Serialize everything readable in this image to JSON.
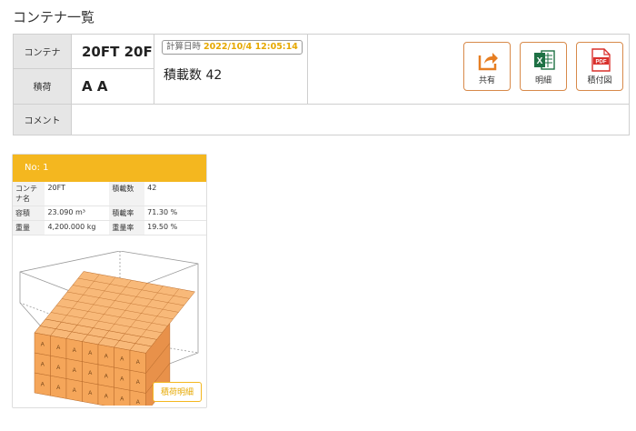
{
  "page_title": "コンテナ一覧",
  "summary": {
    "container_label": "コンテナ",
    "container_value": "20FT 20F",
    "cargo_label": "積荷",
    "cargo_value": "A A",
    "comment_label": "コメント",
    "comment_value": "",
    "calc_label": "計算日時",
    "calc_datetime": "2022/10/4 12:05:14",
    "load_count": "積載数 42"
  },
  "actions": [
    {
      "label": "共有",
      "icon": "share-icon",
      "color": "#e67e22"
    },
    {
      "label": "明細",
      "icon": "excel-icon",
      "color": "#1e7145"
    },
    {
      "label": "積付図",
      "icon": "pdf-icon",
      "color": "#d9302c"
    }
  ],
  "card": {
    "header": "No: 1",
    "rows": [
      {
        "k1": "コンテナ名",
        "v1": "20FT",
        "k2": "積載数",
        "v2": "42"
      },
      {
        "k1": "容積",
        "v1": "23.090 m³",
        "k2": "積載率",
        "v2": "71.30 %"
      },
      {
        "k1": "重量",
        "v1": "4,200.000 kg",
        "k2": "重量率",
        "v2": "19.50 %"
      }
    ],
    "box_label": "A",
    "detail_button": "積荷明細"
  },
  "colors": {
    "accent": "#f4b71f",
    "box_face": "#f5a65a",
    "box_top": "#f8b979",
    "box_side": "#e8914a"
  }
}
